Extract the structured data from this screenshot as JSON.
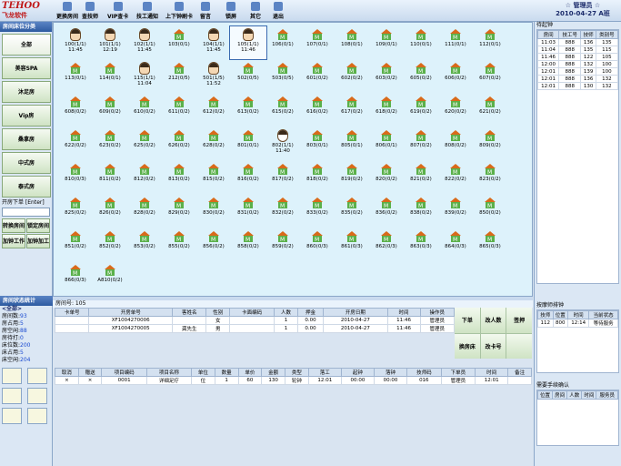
{
  "app": {
    "logo_main": "TEHOO",
    "logo_sub": "飞龙软件",
    "user": "☆ 管理员 ☆",
    "date": "2010-04-27 A班"
  },
  "toolbar": [
    {
      "label": "更换房间",
      "icon": "door-icon"
    },
    {
      "label": "查技师",
      "icon": "people-icon"
    },
    {
      "label": "VIP查卡",
      "icon": "card-icon"
    },
    {
      "label": "技工通知",
      "icon": "bell-icon"
    },
    {
      "label": "上下钟刷卡",
      "icon": "clock-icon"
    },
    {
      "label": "留言",
      "icon": "message-icon"
    },
    {
      "label": "锁屏",
      "icon": "lock-icon"
    },
    {
      "label": "其它",
      "icon": "gear-icon"
    },
    {
      "label": "退出",
      "icon": "exit-icon"
    }
  ],
  "left": {
    "title": "房间床位分类",
    "categories": [
      "全部",
      "美容SPA",
      "沐足房",
      "Vip房",
      "桑拿房",
      "中式房",
      "泰式房"
    ],
    "input_label": "开房下单 [Enter]",
    "buttons": [
      "转换房间",
      "锁定房间",
      "加钟工作",
      "加钟加工"
    ],
    "stats_title": "房间状态统计",
    "filter": "<全部>",
    "stats": [
      {
        "k": "房间数:",
        "v": "93"
      },
      {
        "k": "房占用:",
        "v": "5"
      },
      {
        "k": "房空闲:",
        "v": "88"
      },
      {
        "k": "房待打:",
        "v": "0"
      },
      {
        "k": "床位数:",
        "v": "200"
      },
      {
        "k": "床占用:",
        "v": "5"
      },
      {
        "k": "床空闲:",
        "v": "204"
      }
    ]
  },
  "rooms": [
    [
      "100(1/1) 11:45",
      "101(1/1) 12:19",
      "102(1/1) 11:45",
      "103(0/1)",
      "104(1/1) 11:45",
      "105(1/1) 11:46",
      "106(0/1)",
      "107(0/1)",
      "108(0/1)",
      "109(0/1)",
      "110(0/1)",
      "111(0/1)",
      "112(0/1)"
    ],
    [
      "113(0/1)",
      "114(0/1)",
      "115(1/1) 11:04",
      "212(0/5)",
      "501(1/5) 11:52",
      "502(0/5)",
      "503(0/5)",
      "601(0/2)",
      "602(0/2)",
      "603(0/2)",
      "605(0/2)",
      "606(0/2)",
      "607(0/2)"
    ],
    [
      "608(0/2)",
      "609(0/2)",
      "610(0/2)",
      "611(0/2)",
      "612(0/2)",
      "613(0/2)",
      "615(0/2)",
      "616(0/2)",
      "617(0/2)",
      "618(0/2)",
      "619(0/2)",
      "620(0/2)",
      "621(0/2)"
    ],
    [
      "622(0/2)",
      "623(0/2)",
      "625(0/2)",
      "626(0/2)",
      "628(0/2)",
      "801(0/1)",
      "802(1/1) 11:40",
      "803(0/1)",
      "805(0/1)",
      "806(0/1)",
      "807(0/2)",
      "808(0/2)",
      "809(0/2)"
    ],
    [
      "810(0/3)",
      "811(0/2)",
      "812(0/2)",
      "813(0/2)",
      "815(0/2)",
      "816(0/2)",
      "817(0/2)",
      "818(0/2)",
      "819(0/2)",
      "820(0/2)",
      "821(0/2)",
      "822(0/2)",
      "823(0/2)"
    ],
    [
      "825(0/2)",
      "826(0/2)",
      "828(0/2)",
      "829(0/2)",
      "830(0/2)",
      "831(0/2)",
      "832(0/2)",
      "833(0/2)",
      "835(0/2)",
      "836(0/2)",
      "838(0/2)",
      "839(0/2)",
      "850(0/2)"
    ],
    [
      "851(0/2)",
      "852(0/2)",
      "853(0/2)",
      "855(0/2)",
      "856(0/2)",
      "858(0/2)",
      "859(0/2)",
      "860(0/3)",
      "861(0/3)",
      "862(0/3)",
      "863(0/3)",
      "864(0/3)",
      "865(0/3)"
    ],
    [
      "866(0/3)",
      "A810(0/2)"
    ]
  ],
  "occupied_with_face": [
    "100(1/1) 11:45",
    "101(1/1) 12:19",
    "102(1/1) 11:45",
    "104(1/1) 11:45",
    "105(1/1) 11:46",
    "115(1/1) 11:04",
    "501(1/5) 11:52"
  ],
  "occupied_with_timer": [
    "802(1/1) 11:40"
  ],
  "middle": {
    "room_label": "房间号: 105"
  },
  "guest_table": {
    "headers": [
      "卡单号",
      "开房单号",
      "客姓名",
      "性别",
      "卡面编码",
      "人数",
      "押金",
      "开房日期",
      "时间",
      "操作员"
    ],
    "rows": [
      [
        "",
        "XF1004270006",
        "",
        "女",
        "",
        "1",
        "0.00",
        "2010-04-27",
        "11:46",
        "管理员"
      ],
      [
        "",
        "XF1004270005",
        "龚先生",
        "男",
        "",
        "1",
        "0.00",
        "2010-04-27",
        "11:46",
        "管理员"
      ]
    ]
  },
  "actions": [
    "下单",
    "改人数",
    "签押",
    "换房床",
    "改卡号",
    ""
  ],
  "items_table": {
    "headers": [
      "取消",
      "赠送",
      "项目编码",
      "项目名称",
      "单位",
      "数量",
      "单价",
      "金额",
      "类型",
      "落工",
      "起钟",
      "落钟",
      "技师码",
      "下单员",
      "时间",
      "备注"
    ],
    "rows": [
      [
        "×",
        "×",
        "0001",
        "详细足疗",
        "位",
        "1",
        "60",
        "130",
        "轮钟",
        "12:01",
        "00:00",
        "00:00",
        "016",
        "管理员",
        "12:01",
        ""
      ]
    ]
  },
  "right": {
    "top_title": "待起钟",
    "top_headers": [
      "房间",
      "技工号",
      "技师",
      "类别号"
    ],
    "top_rows": [
      [
        "11:03",
        "888",
        "136",
        "135"
      ],
      [
        "11:04",
        "888",
        "135",
        "115"
      ],
      [
        "11:46",
        "888",
        "122",
        "105"
      ],
      [
        "12:00",
        "888",
        "132",
        "100"
      ],
      [
        "12:01",
        "888",
        "139",
        "100"
      ],
      [
        "12:01",
        "888",
        "136",
        "132"
      ],
      [
        "12:01",
        "888",
        "130",
        "132"
      ]
    ],
    "mid_title": "按摩师排钟",
    "mid_headers": [
      "技师",
      "位置",
      "时间",
      "当前状态"
    ],
    "mid_rows": [
      [
        "112",
        "800",
        "12:14",
        "等待服务"
      ]
    ],
    "bot_title": "需要手续确认",
    "bot_headers": [
      "位置",
      "房间",
      "人数",
      "时间",
      "服务员"
    ]
  }
}
